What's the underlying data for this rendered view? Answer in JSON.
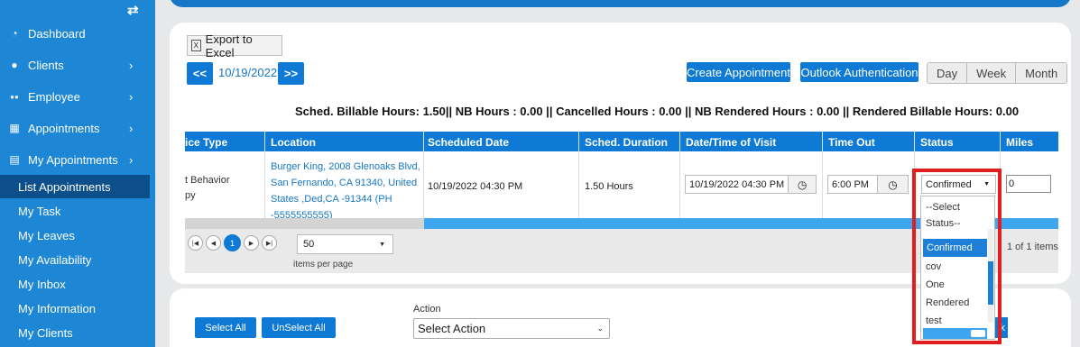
{
  "sidebar": {
    "collapse_icon": "⇄",
    "items": [
      {
        "label": "Dashboard",
        "icon": "dashboard-icon",
        "glyph": "◔",
        "has_chevron": false
      },
      {
        "label": "Clients",
        "icon": "user-icon",
        "glyph": "●",
        "has_chevron": true
      },
      {
        "label": "Employee",
        "icon": "users-icon",
        "glyph": "●●",
        "has_chevron": true
      },
      {
        "label": "Appointments",
        "icon": "calendar-icon",
        "glyph": "▦",
        "has_chevron": true
      },
      {
        "label": "My Appointments",
        "icon": "clipboard-icon",
        "glyph": "▤",
        "has_chevron": true
      }
    ],
    "chevron": "›",
    "sub_items": [
      {
        "label": "List Appointments",
        "active": true
      },
      {
        "label": "My Task"
      },
      {
        "label": "My Leaves"
      },
      {
        "label": "My Availability"
      },
      {
        "label": "My Inbox"
      },
      {
        "label": "My Information"
      },
      {
        "label": "My Clients"
      }
    ]
  },
  "toolbar": {
    "export_label": "Export to Excel",
    "prev_label": "<<",
    "next_label": ">>",
    "current_date": "10/19/2022",
    "create_label": "Create Appointment",
    "outlook_label": "Outlook Authentication",
    "views": [
      "Day",
      "Week",
      "Month"
    ]
  },
  "summary": "Sched. Billable Hours: 1.50|| NB Hours : 0.00 || Cancelled Hours : 0.00 || NB Rendered Hours : 0.00 || Rendered Billable Hours: 0.00",
  "grid": {
    "columns": [
      "ice Type",
      "Location",
      "Scheduled Date",
      "Sched. Duration",
      "Date/Time of Visit",
      "Time Out",
      "Status",
      "Miles"
    ],
    "row": {
      "service_line1": "t Behavior",
      "service_line2": "py",
      "location": [
        "Burger King, 2008 Glenoaks Blvd,",
        "San Fernando, CA 91340, United",
        "States ,Ded,CA -91344 (PH",
        "-5555555555)"
      ],
      "scheduled_date": "10/19/2022 04:30 PM",
      "duration": "1.50 Hours",
      "visit_datetime": "10/19/2022 04:30 PM",
      "time_out": "6:00 PM",
      "status": "Confirmed",
      "miles": "0"
    },
    "pager": {
      "first": "|◀",
      "prev": "◀",
      "current_page": "1",
      "next": "▶",
      "last": "▶|",
      "page_size": "50",
      "items_per_page_label": "items per page",
      "item_count_text": "1 of 1 items"
    }
  },
  "status_dropdown": {
    "options": [
      "--Select",
      "Status--",
      "Confirmed",
      "cov",
      "One",
      "Rendered",
      "test"
    ],
    "selected": "Confirmed"
  },
  "bottom": {
    "select_all_label": "Select All",
    "unselect_all_label": "UnSelect All",
    "action_label": "Action",
    "action_value": "Select Action",
    "partial_button_label": "k"
  },
  "colors": {
    "sidebar_bg": "#1d87d6",
    "accent": "#0e7ad6",
    "highlight": "#e11d1d"
  }
}
